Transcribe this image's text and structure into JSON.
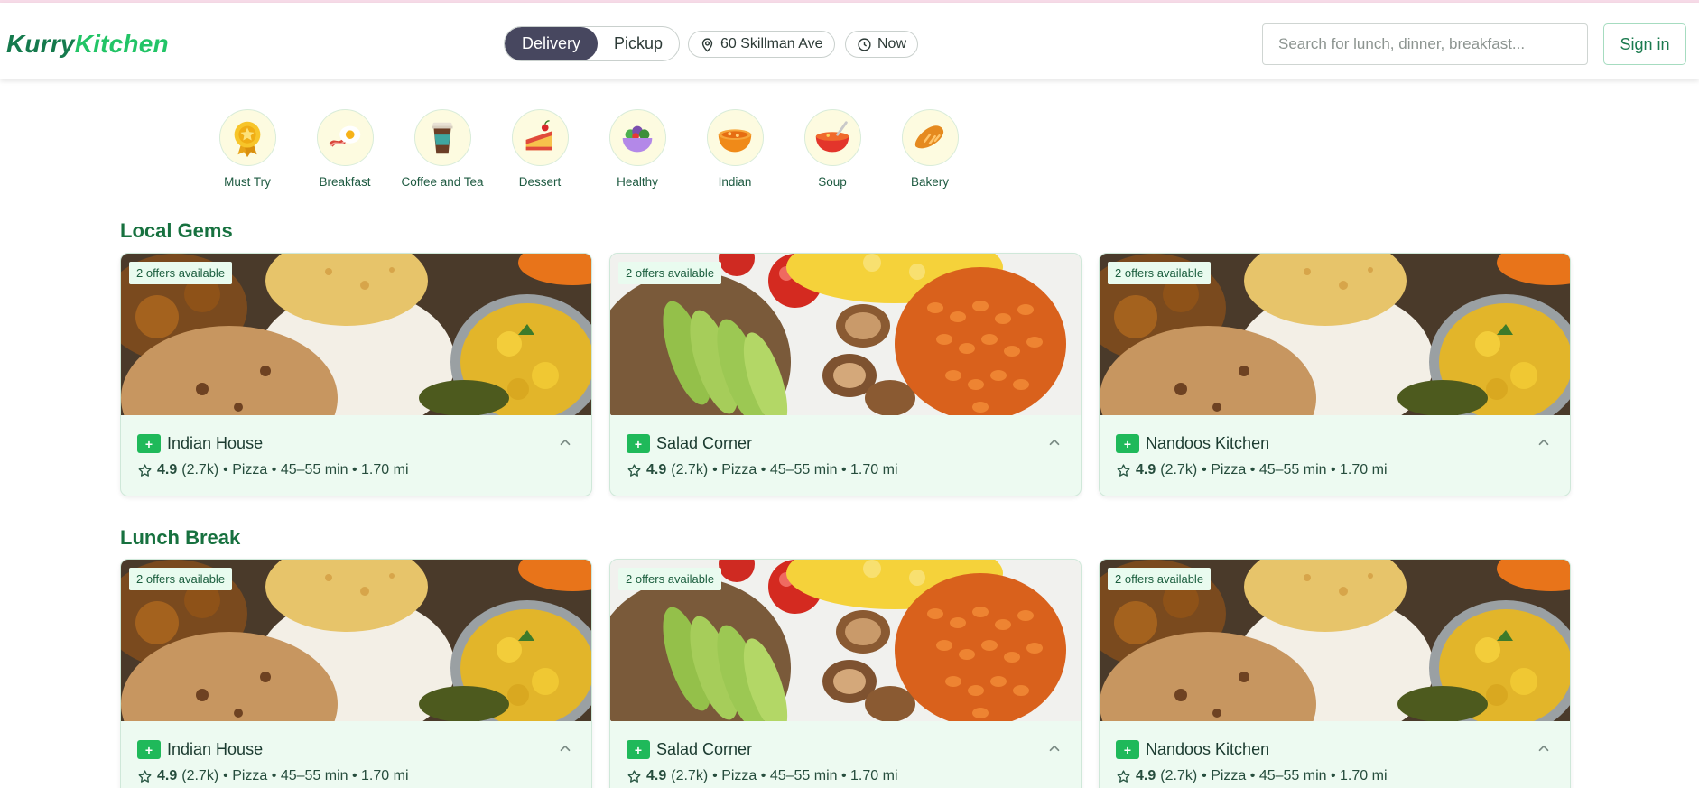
{
  "brand": {
    "part1": "Kurry",
    "part2": "Kitchen"
  },
  "order_mode": {
    "options": [
      "Delivery",
      "Pickup"
    ],
    "selected": "Delivery"
  },
  "address": {
    "label": "60 Skillman Ave",
    "icon": "map-pin-icon"
  },
  "time": {
    "label": "Now",
    "icon": "clock-icon"
  },
  "search": {
    "placeholder": "Search for lunch, dinner, breakfast..."
  },
  "sign_in": "Sign in",
  "categories": [
    {
      "label": "Must Try",
      "icon": "medal-icon"
    },
    {
      "label": "Breakfast",
      "icon": "bacon-egg-icon"
    },
    {
      "label": "Coffee and Tea",
      "icon": "coffee-cup-icon"
    },
    {
      "label": "Dessert",
      "icon": "cake-icon"
    },
    {
      "label": "Healthy",
      "icon": "salad-bowl-icon"
    },
    {
      "label": "Indian",
      "icon": "curry-bowl-icon"
    },
    {
      "label": "Soup",
      "icon": "soup-icon"
    },
    {
      "label": "Bakery",
      "icon": "bread-icon"
    }
  ],
  "sections": [
    {
      "title": "Local Gems",
      "cards": [
        {
          "name": "Indian House",
          "offer": "2 offers available",
          "rating": "4.9",
          "reviews": "(2.7k)",
          "details": "• Pizza • 45–55 min • 1.70 mi",
          "image": "indian-platter"
        },
        {
          "name": "Salad Corner",
          "offer": "2 offers available",
          "rating": "4.9",
          "reviews": "(2.7k)",
          "details": "• Pizza • 45–55 min • 1.70 mi",
          "image": "breakfast-plate"
        },
        {
          "name": "Nandoos Kitchen",
          "offer": "2 offers available",
          "rating": "4.9",
          "reviews": "(2.7k)",
          "details": "• Pizza • 45–55 min • 1.70 mi",
          "image": "indian-platter"
        }
      ]
    },
    {
      "title": "Lunch Break",
      "cards": [
        {
          "name": "Indian House",
          "offer": "2 offers available",
          "rating": "4.9",
          "reviews": "(2.7k)",
          "details": "• Pizza • 45–55 min • 1.70 mi",
          "image": "indian-platter"
        },
        {
          "name": "Salad Corner",
          "offer": "2 offers available",
          "rating": "4.9",
          "reviews": "(2.7k)",
          "details": "• Pizza • 45–55 min • 1.70 mi",
          "image": "breakfast-plate"
        },
        {
          "name": "Nandoos Kitchen",
          "offer": "2 offers available",
          "rating": "4.9",
          "reviews": "(2.7k)",
          "details": "• Pizza • 45–55 min • 1.70 mi",
          "image": "indian-platter"
        }
      ]
    }
  ],
  "colors": {
    "brand_dark": "#157a4d",
    "brand_light": "#22c466",
    "card_bg": "#edfaf1",
    "toggle_active": "#47475f"
  }
}
